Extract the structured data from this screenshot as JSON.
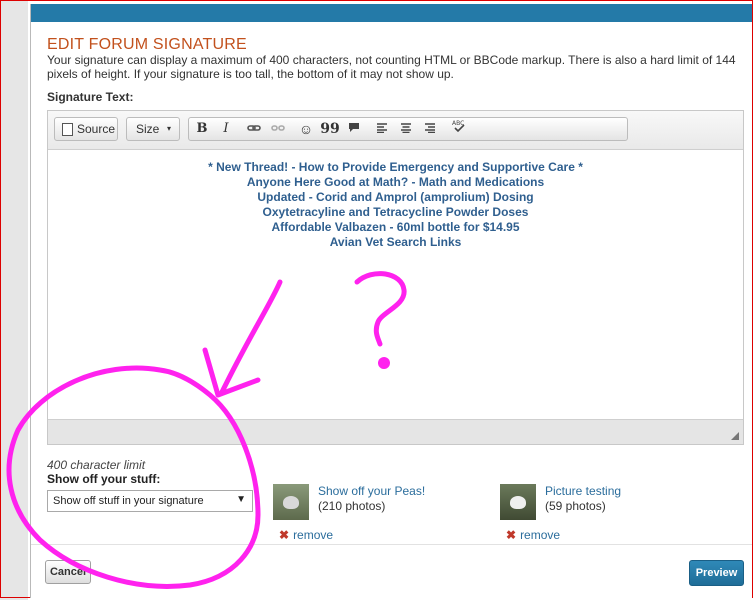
{
  "dialog": {
    "title": "EDIT FORUM SIGNATURE",
    "description": "Your signature can display a maximum of 400 characters, not counting HTML or BBCode markup. There is also a hard limit of 144 pixels of height. If your signature is too tall, the bottom of it may not show up.",
    "signature_label": "Signature Text:"
  },
  "toolbar": {
    "source_label": "Source",
    "size_label": "Size",
    "bold_label": "B",
    "italic_label": "I",
    "quote_label": "99"
  },
  "signature_lines": [
    "* New Thread! - How to Provide Emergency and Supportive Care *",
    "Anyone Here Good at Math? - Math and Medications",
    "Updated - Corid and Amprol (amprolium) Dosing",
    "Oxytetracyline and Tetracycline Powder Doses",
    "Affordable Valbazen - 60ml bottle for $14.95",
    "Avian Vet Search Links"
  ],
  "char_limit": "400 character limit",
  "stuff": {
    "label": "Show off your stuff:",
    "selected": "Show off stuff in your signature"
  },
  "albums": [
    {
      "name": "Show off your Peas!",
      "count": "(210 photos)",
      "remove": "remove"
    },
    {
      "name": "Picture testing",
      "count": "(59 photos)",
      "remove": "remove"
    }
  ],
  "buttons": {
    "cancel": "Cancel",
    "preview": "Preview"
  },
  "colors": {
    "title": "#c2511d",
    "topbar": "#247aa8",
    "link": "#2f5f8f",
    "annotation": "#ff22ee"
  }
}
